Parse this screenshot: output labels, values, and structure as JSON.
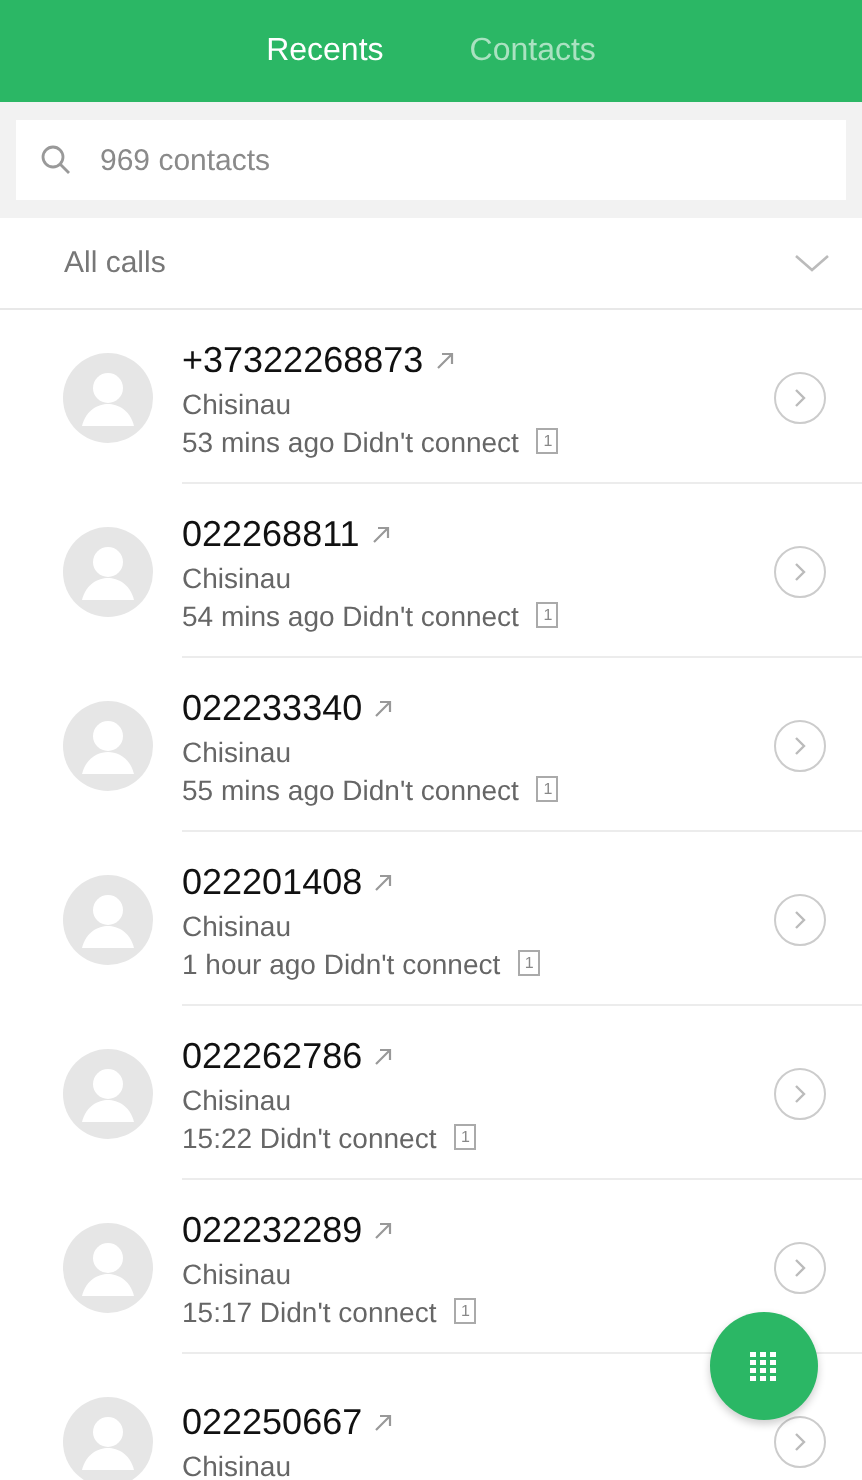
{
  "tabs": [
    {
      "label": "Recents",
      "selected": true
    },
    {
      "label": "Contacts",
      "selected": false
    }
  ],
  "search": {
    "placeholder": "969 contacts"
  },
  "filter": {
    "label": "All calls"
  },
  "calls": [
    {
      "number": "+37322268873",
      "location": "Chisinau",
      "detail": "53 mins ago Didn't connect",
      "sim": "1"
    },
    {
      "number": "022268811",
      "location": "Chisinau",
      "detail": "54 mins ago Didn't connect",
      "sim": "1"
    },
    {
      "number": "022233340",
      "location": "Chisinau",
      "detail": "55 mins ago Didn't connect",
      "sim": "1"
    },
    {
      "number": "022201408",
      "location": "Chisinau",
      "detail": "1 hour ago Didn't connect",
      "sim": "1"
    },
    {
      "number": "022262786",
      "location": "Chisinau",
      "detail": "15:22 Didn't connect",
      "sim": "1"
    },
    {
      "number": "022232289",
      "location": "Chisinau",
      "detail": "15:17 Didn't connect",
      "sim": "1"
    },
    {
      "number": "022250667",
      "location": "Chisinau"
    }
  ]
}
